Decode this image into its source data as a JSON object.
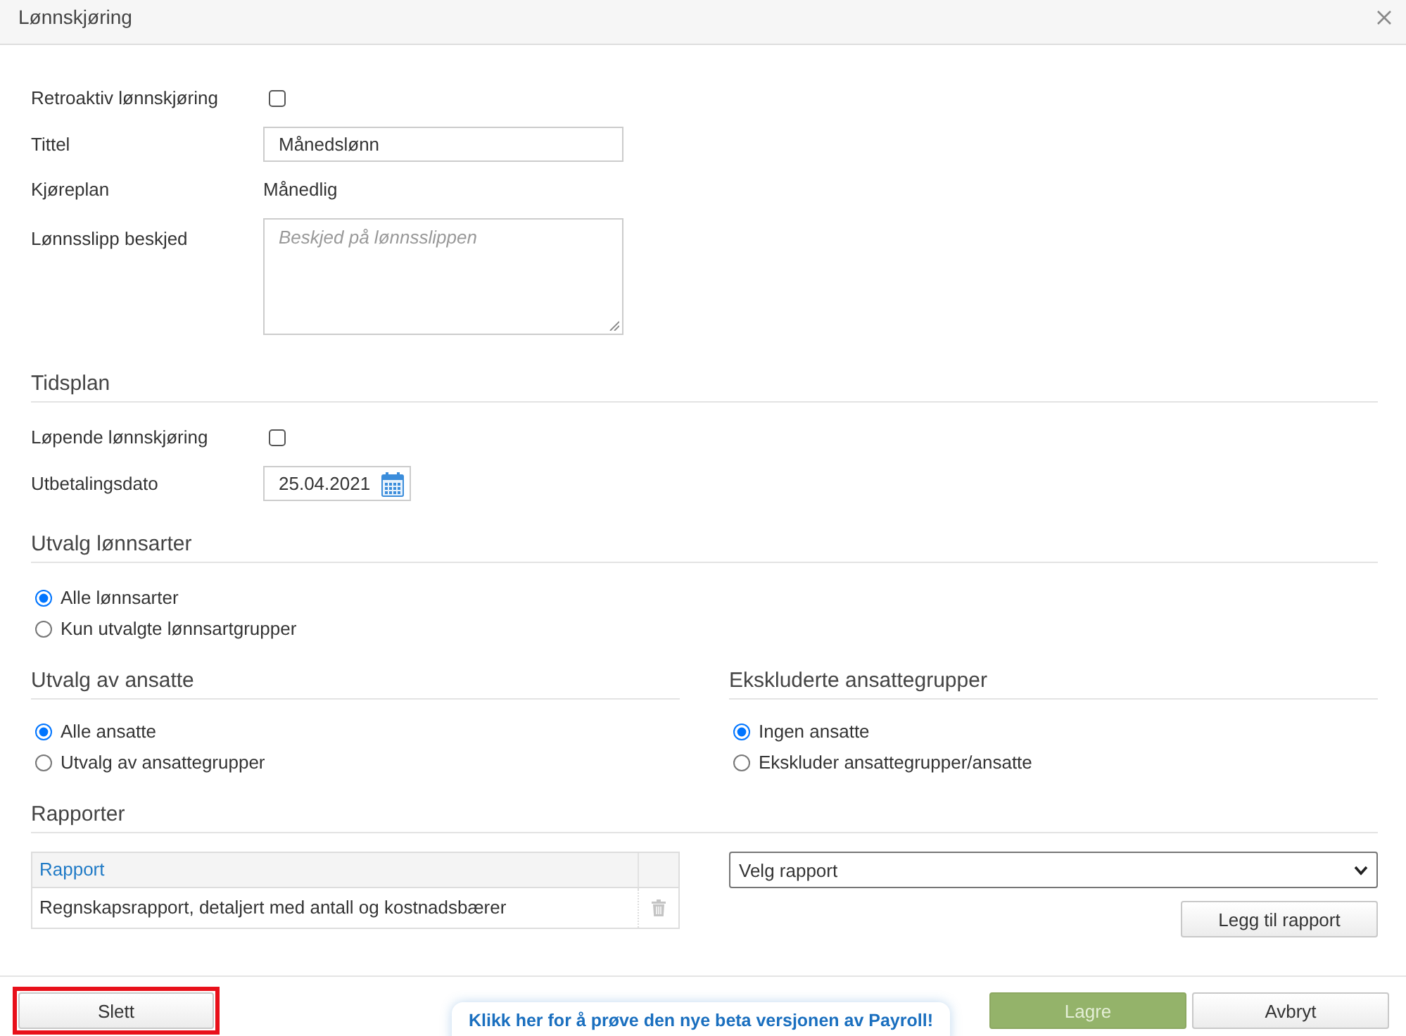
{
  "dialog": {
    "title": "Lønnskjøring"
  },
  "fields": [
    {
      "kind": "checkbox",
      "label": "Retroaktiv lønnskjøring",
      "checked": false
    },
    {
      "kind": "text",
      "label": "Tittel",
      "value": "Månedslønn"
    },
    {
      "kind": "static",
      "label": "Kjøreplan",
      "value": "Månedlig"
    },
    {
      "kind": "textarea",
      "label": "Lønnsslipp beskjed",
      "placeholder": "Beskjed på lønnsslippen"
    }
  ],
  "schedule": {
    "heading": "Tidsplan",
    "fields": [
      {
        "kind": "checkbox",
        "label": "Løpende lønnskjøring",
        "checked": false
      },
      {
        "kind": "date",
        "label": "Utbetalingsdato",
        "value": "25.04.2021"
      }
    ]
  },
  "wage_types": {
    "heading": "Utvalg lønnsarter",
    "options": [
      {
        "label": "Alle lønnsarter",
        "selected": true
      },
      {
        "label": "Kun utvalgte lønnsartgrupper",
        "selected": false
      }
    ]
  },
  "employees": {
    "heading": "Utvalg av ansatte",
    "options": [
      {
        "label": "Alle ansatte",
        "selected": true
      },
      {
        "label": "Utvalg av ansattegrupper",
        "selected": false
      }
    ]
  },
  "excluded_groups": {
    "heading": "Ekskluderte ansattegrupper",
    "options": [
      {
        "label": "Ingen ansatte",
        "selected": true
      },
      {
        "label": "Ekskluder ansattegrupper/ansatte",
        "selected": false
      }
    ]
  },
  "reports": {
    "heading": "Rapporter",
    "table": {
      "columns": [
        "Rapport"
      ],
      "rows": [
        [
          "Regnskapsrapport, detaljert med antall og kostnadsbærer"
        ]
      ]
    },
    "select": {
      "value": "Velg rapport"
    },
    "add_button": "Legg til rapport"
  },
  "footer": {
    "left_buttons": [
      {
        "label": "Slett",
        "kind": "default",
        "highlighted": true
      }
    ],
    "right_buttons": [
      {
        "label": "Lagre",
        "kind": "primary",
        "highlighted": false
      },
      {
        "label": "Avbryt",
        "kind": "default",
        "highlighted": false
      }
    ]
  },
  "banner": {
    "link": "Klikk her for å prøve den nye beta versjonen av Payroll!"
  }
}
